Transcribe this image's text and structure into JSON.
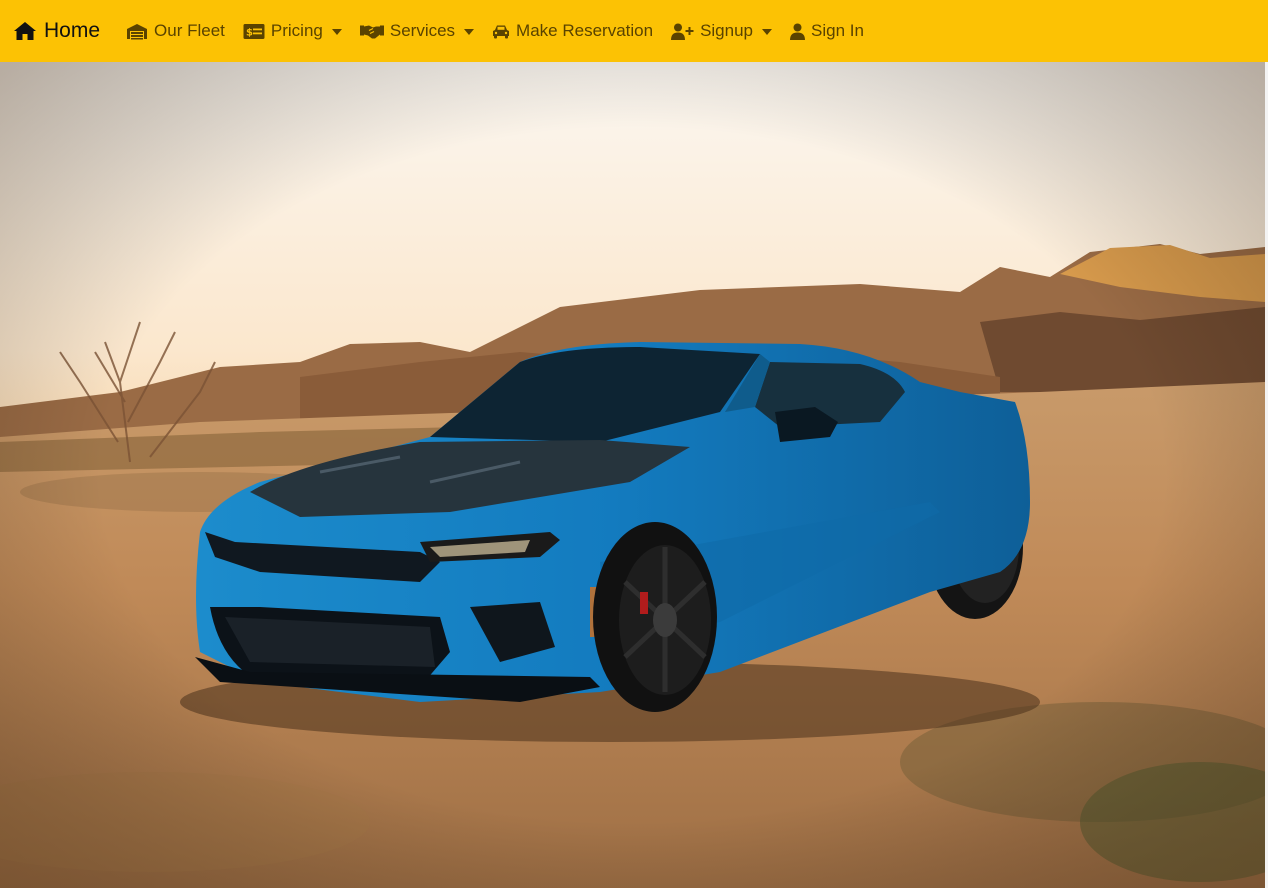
{
  "navbar": {
    "brand": {
      "label": "Home",
      "icon": "home-icon"
    },
    "items": [
      {
        "label": "Our Fleet",
        "icon": "garage-icon",
        "dropdown": false
      },
      {
        "label": "Pricing",
        "icon": "money-bill-icon",
        "dropdown": true
      },
      {
        "label": "Services",
        "icon": "handshake-icon",
        "dropdown": true
      },
      {
        "label": "Make Reservation",
        "icon": "car-icon",
        "dropdown": false
      },
      {
        "label": "Signup",
        "icon": "user-plus-icon",
        "dropdown": true
      },
      {
        "label": "Sign In",
        "icon": "user-icon",
        "dropdown": false
      }
    ]
  },
  "colors": {
    "navbar_background": "#fcc204",
    "nav_text": "#5a4300",
    "brand_text": "#111111",
    "car_body": "#1a8fd2"
  },
  "hero": {
    "image": "blue sports car on desert dirt road at sunset"
  }
}
